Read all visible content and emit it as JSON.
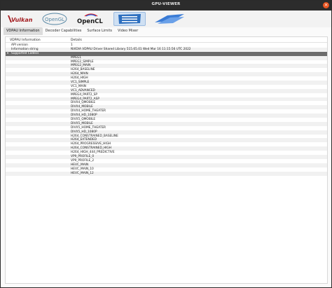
{
  "window": {
    "title": "GPU-VIEWER",
    "close_glyph": "×"
  },
  "api_icons": [
    {
      "name": "vulkan",
      "label": "Vulkan",
      "color": "#a41e22"
    },
    {
      "name": "opengl",
      "label": "OpenGL",
      "color": "#5586a4"
    },
    {
      "name": "opencl",
      "label": "OpenCL",
      "color": "#1a1a1a"
    },
    {
      "name": "vdpau",
      "label": "",
      "color": "#2d6fbf"
    },
    {
      "name": "vaapi",
      "label": "",
      "color": "#3a7bd5"
    }
  ],
  "tabs": [
    {
      "label": "VDPAU Information",
      "active": true
    },
    {
      "label": "Decoder Capabilities",
      "active": false
    },
    {
      "label": "Surface Limits",
      "active": false
    },
    {
      "label": "Video Mixer",
      "active": false
    }
  ],
  "table": {
    "headers": {
      "key": "VDPAU Information",
      "value": "Details"
    },
    "rows": [
      {
        "key": "API version",
        "value": "1"
      },
      {
        "key": "Information string",
        "value": "NVIDIA VDPAU Driver Shared Library 515.65.01 Wed Mar 16 11:15:56 UTC 2022"
      }
    ],
    "group_label": "Supported Codecs",
    "group_glyph": "▾",
    "codecs": [
      "MPEG1",
      "MPEG2_SIMPLE",
      "MPEG2_MAIN",
      "H264_BASELINE",
      "H264_MAIN",
      "H264_HIGH",
      "VC1_SIMPLE",
      "VC1_MAIN",
      "VC1_ADVANCED",
      "MPEG4_PART2_SP",
      "MPEG4_PART2_ASP",
      "DIVX4_QMOBILE",
      "DIVX4_MOBILE",
      "DIVX4_HOME_THEATER",
      "DIVX4_HD_1080P",
      "DIVX5_QMOBILE",
      "DIVX5_MOBILE",
      "DIVX5_HOME_THEATER",
      "DIVX5_HD_1080P",
      "H264_CONSTRAINED_BASELINE",
      "H264_EXTENDED",
      "H264_PROGRESSIVE_HIGH",
      "H264_CONSTRAINED_HIGH",
      "H264_HIGH_444_PREDICTIVE",
      "VP9_PROFILE_0",
      "VP9_PROFILE_2",
      "HEVC_MAIN",
      "HEVC_MAIN_10",
      "HEVC_MAIN_12"
    ]
  }
}
